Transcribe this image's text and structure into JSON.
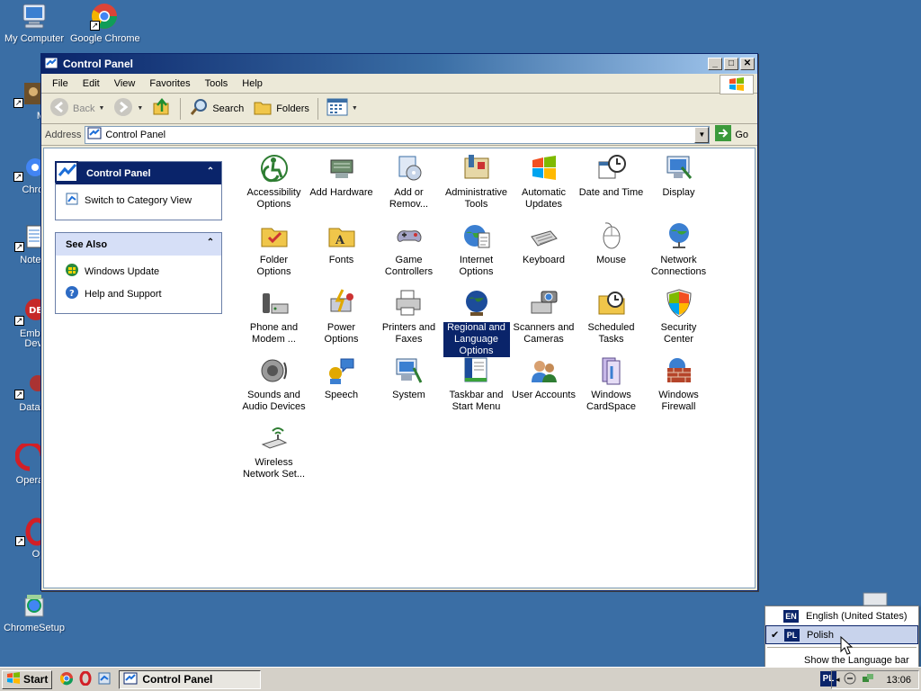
{
  "desktop": {
    "icons": [
      {
        "label": "My Computer"
      },
      {
        "label": "Google Chrome"
      },
      {
        "label": "MyPa"
      },
      {
        "label": "Chrom"
      },
      {
        "label": "Notepa"
      },
      {
        "label": "Embarc"
      },
      {
        "label": "Dev-C"
      },
      {
        "label": "DataWa"
      },
      {
        "label": "Opera_w"
      },
      {
        "label": "Ope"
      },
      {
        "label": "ChromeSetup"
      }
    ]
  },
  "window": {
    "title": "Control Panel",
    "menu": [
      "File",
      "Edit",
      "View",
      "Favorites",
      "Tools",
      "Help"
    ],
    "toolbar": {
      "back": "Back",
      "search": "Search",
      "folders": "Folders"
    },
    "address": {
      "label": "Address",
      "value": "Control Panel",
      "go": "Go"
    },
    "taskpane": {
      "main_title": "Control Panel",
      "switch_link": "Switch to Category View",
      "see_also_title": "See Also",
      "see_also_links": [
        "Windows Update",
        "Help and Support"
      ]
    },
    "items": [
      {
        "label": "Accessibility Options",
        "icon": "accessibility-icon"
      },
      {
        "label": "Add Hardware",
        "icon": "add-hardware-icon"
      },
      {
        "label": "Add or Remov...",
        "icon": "add-remove-programs-icon"
      },
      {
        "label": "Administrative Tools",
        "icon": "administrative-tools-icon"
      },
      {
        "label": "Automatic Updates",
        "icon": "automatic-updates-icon"
      },
      {
        "label": "Date and Time",
        "icon": "date-time-icon"
      },
      {
        "label": "Display",
        "icon": "display-icon"
      },
      {
        "label": "Folder Options",
        "icon": "folder-options-icon"
      },
      {
        "label": "Fonts",
        "icon": "fonts-icon"
      },
      {
        "label": "Game Controllers",
        "icon": "game-controllers-icon"
      },
      {
        "label": "Internet Options",
        "icon": "internet-options-icon"
      },
      {
        "label": "Keyboard",
        "icon": "keyboard-icon"
      },
      {
        "label": "Mouse",
        "icon": "mouse-icon"
      },
      {
        "label": "Network Connections",
        "icon": "network-connections-icon"
      },
      {
        "label": "Phone and Modem ...",
        "icon": "phone-modem-icon"
      },
      {
        "label": "Power Options",
        "icon": "power-options-icon"
      },
      {
        "label": "Printers and Faxes",
        "icon": "printers-faxes-icon"
      },
      {
        "label": "Regional and Language Options",
        "icon": "regional-language-icon",
        "selected": true
      },
      {
        "label": "Scanners and Cameras",
        "icon": "scanners-cameras-icon"
      },
      {
        "label": "Scheduled Tasks",
        "icon": "scheduled-tasks-icon"
      },
      {
        "label": "Security Center",
        "icon": "security-center-icon"
      },
      {
        "label": "Sounds and Audio Devices",
        "icon": "sounds-audio-icon"
      },
      {
        "label": "Speech",
        "icon": "speech-icon"
      },
      {
        "label": "System",
        "icon": "system-icon"
      },
      {
        "label": "Taskbar and Start Menu",
        "icon": "taskbar-start-menu-icon"
      },
      {
        "label": "User Accounts",
        "icon": "user-accounts-icon"
      },
      {
        "label": "Windows CardSpace",
        "icon": "cardspace-icon"
      },
      {
        "label": "Windows Firewall",
        "icon": "firewall-icon"
      },
      {
        "label": "Wireless Network Set...",
        "icon": "wireless-network-icon"
      }
    ]
  },
  "language_menu": {
    "items": [
      {
        "code": "EN",
        "label": "English (United States)",
        "checked": false
      },
      {
        "code": "PL",
        "label": "Polish",
        "checked": true
      }
    ],
    "show_bar": "Show the Language bar"
  },
  "taskbar": {
    "start": "Start",
    "task": "Control Panel",
    "lang_indicator": "PL",
    "clock": "13:06"
  },
  "colors": {
    "desktop": "#3a6ea5",
    "title_dark": "#0a246a",
    "selection": "#0a246a"
  }
}
